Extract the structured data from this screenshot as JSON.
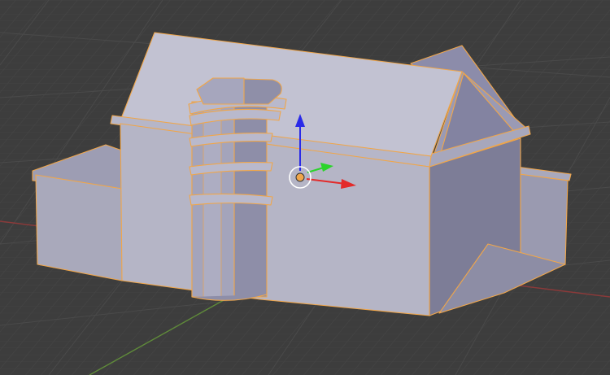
{
  "viewport": {
    "object": "house-mesh",
    "selected": true,
    "colors": {
      "background": "#3d3d3d",
      "grid_minor": "#474747",
      "grid_major": "#515151",
      "x_axis": "#8a3a3a",
      "y_axis": "#5f8a3a",
      "selection_outline": "#f0a64a",
      "mesh_face_light": "#c2c2d2",
      "mesh_face_mid": "#a9a9bc",
      "mesh_face_dark": "#8585a0",
      "gizmo_x": "#e32a2a",
      "gizmo_y": "#2ad42a",
      "gizmo_z": "#2a2ae8",
      "pivot": "#f0a64a"
    },
    "gizmo": {
      "axes": [
        "x",
        "y",
        "z"
      ]
    }
  }
}
